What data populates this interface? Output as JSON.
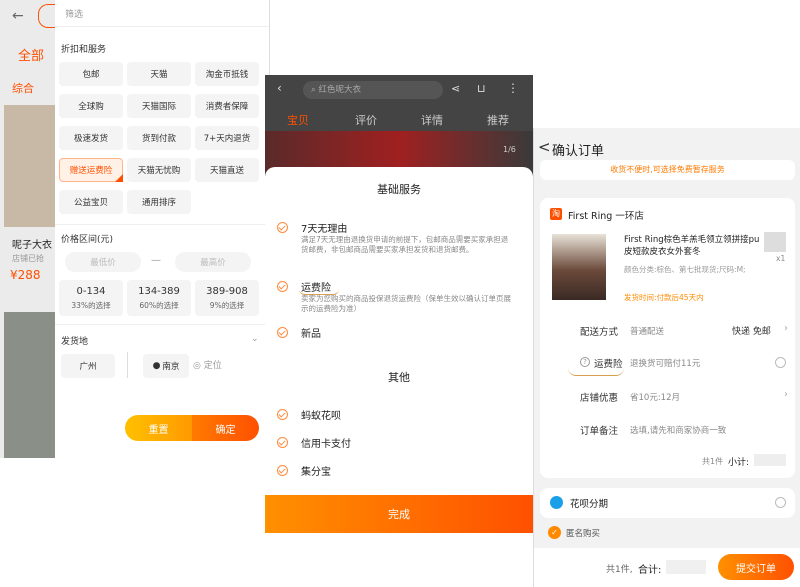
{
  "screen1": {
    "back_glyph": "←",
    "tab_all": "全部",
    "sort_label": "综合",
    "filter_title": "筛选",
    "discount_title": "折扣和服务",
    "chips": [
      "包邮",
      "天猫",
      "淘金币抵钱",
      "全球购",
      "天猫国际",
      "消费者保障",
      "极速发货",
      "货到付款",
      "7+天内退货",
      "赠送运费险",
      "天猫无忧购",
      "天猫直送",
      "公益宝贝",
      "通用排序"
    ],
    "selected_chip_index": 9,
    "price_title": "价格区间(元)",
    "min_placeholder": "最低价",
    "max_placeholder": "最高价",
    "price_dash": "—",
    "price_ranges": [
      {
        "range": "0-134",
        "pct": "33%的选择"
      },
      {
        "range": "134-389",
        "pct": "60%的选择"
      },
      {
        "range": "389-908",
        "pct": "9%的选择"
      }
    ],
    "ship_title": "发货地",
    "loc1": "广州",
    "loc2": "南京",
    "locate": "定位",
    "reset": "重置",
    "confirm": "确定",
    "left_items": [
      {
        "title": "呢子大衣",
        "sub": "店铺已抢",
        "price": "¥288"
      }
    ],
    "colors": {
      "orange": "#ff5000",
      "orange_light": "#ff9a00"
    }
  },
  "screen2": {
    "search_text": "红色呢大衣",
    "tabs": [
      "宝贝",
      "评价",
      "详情",
      "推荐"
    ],
    "page_indicator": "1/6",
    "sheet_title": "基础服务",
    "services": [
      {
        "name": "7天无理由",
        "desc": "满足7天无理由退换货申请的前提下，包邮商品需要买家承担退货邮费，非包邮商品需要买家承担发货和退货邮费。"
      },
      {
        "name": "运费险",
        "desc": "卖家为您购买的商品投保退货运费险（保单生效以确认订单页展示的运费险为准）"
      },
      {
        "name": "新品",
        "desc": ""
      }
    ],
    "other_title": "其他",
    "others": [
      "蚂蚁花呗",
      "信用卡支付",
      "集分宝"
    ],
    "done": "完成"
  },
  "screen3": {
    "back_glyph": "<",
    "title": "确认订单",
    "notice": "收货不便时,可选择免费暂存服务",
    "shop_badge": "淘",
    "shop_name": "First Ring 一环店",
    "product_title": "First Ring棕色羊羔毛领立领拼接pu皮短款皮衣女外套冬",
    "product_attrs": "颜色分类:棕色、第七批现货;尺码:M;",
    "delivery_time": "发货时间:付款后45天内",
    "qty": "x1",
    "rows": [
      {
        "label": "配送方式",
        "value": "普通配送",
        "right": "快递 免邮"
      },
      {
        "label": "运费险",
        "value": "退换货可赔付11元",
        "right": ""
      },
      {
        "label": "店铺优惠",
        "value": "省10元:12月",
        "right": ""
      },
      {
        "label": "订单备注",
        "value": "选填,请先和商家协商一致",
        "right": ""
      }
    ],
    "subtotal_count": "共1件",
    "subtotal_label": "小计:",
    "huabei": "花呗分期",
    "anonymous": "匿名购买",
    "footer_count": "共1件,",
    "footer_total": "合计:",
    "submit": "提交订单"
  }
}
